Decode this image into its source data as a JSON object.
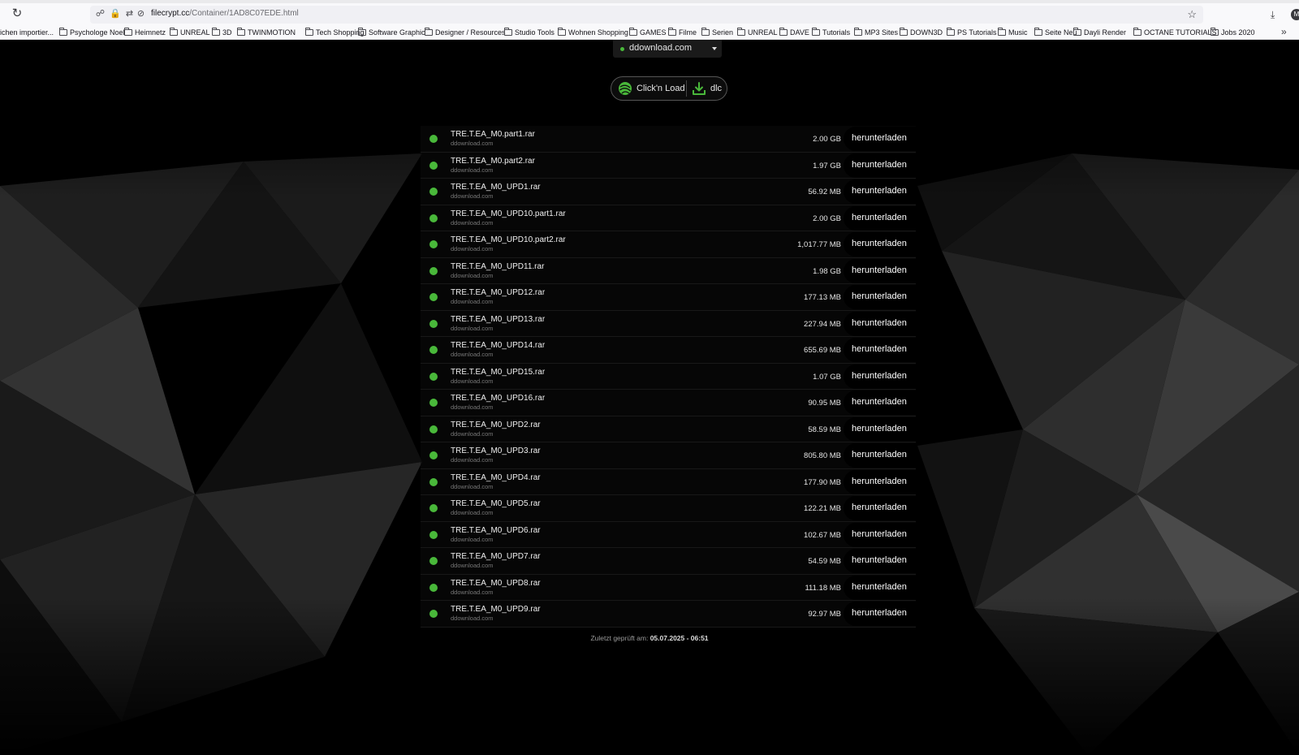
{
  "browser": {
    "url_host": "filecrypt.cc",
    "url_path": "/Container/1AD8C07EDE.html",
    "bookmarks": [
      {
        "label": "ichen importier...",
        "folder": false
      },
      {
        "label": "Psychologe Noel",
        "folder": true
      },
      {
        "label": "Heimnetz",
        "folder": true
      },
      {
        "label": "UNREAL",
        "folder": true
      },
      {
        "label": "3D",
        "folder": true
      },
      {
        "label": "TWINMOTION",
        "folder": true
      },
      {
        "label": "Tech Shopping",
        "folder": true
      },
      {
        "label": "Software Graphic",
        "folder": true
      },
      {
        "label": "Designer / Resources",
        "folder": true
      },
      {
        "label": "Studio Tools",
        "folder": true
      },
      {
        "label": "Wohnen Shopping",
        "folder": true
      },
      {
        "label": "GAMES",
        "folder": true
      },
      {
        "label": "Filme",
        "folder": true
      },
      {
        "label": "Serien",
        "folder": true
      },
      {
        "label": "UNREAL",
        "folder": true
      },
      {
        "label": "DAVE",
        "folder": true
      },
      {
        "label": "Tutorials",
        "folder": true
      },
      {
        "label": "MP3 Sites",
        "folder": true
      },
      {
        "label": "DOWN3D",
        "folder": true
      },
      {
        "label": "PS Tutorials",
        "folder": true
      },
      {
        "label": "Music",
        "folder": true
      },
      {
        "label": "Seite Neu",
        "folder": true
      },
      {
        "label": "Dayli Render",
        "folder": true
      },
      {
        "label": "OCTANE TUTORIALS",
        "folder": true
      },
      {
        "label": "Jobs 2020",
        "folder": true
      }
    ],
    "icons": {
      "reload": "reload-icon",
      "shield": "shield-icon",
      "lock": "lock-icon",
      "permissions": "permissions-icon",
      "star": "bookmark-star-icon",
      "downloads": "downloads-icon",
      "account": "account-icon",
      "overflow": "chevron-double-right-icon"
    },
    "account_initial": "M"
  },
  "mirror": {
    "selected": "ddownload.com",
    "status_color": "#49b83a"
  },
  "actions": {
    "clicknload_label": "Click'n Load",
    "dlc_label": "dlc",
    "accent": "#49b83a"
  },
  "files": [
    {
      "name": "TRE.T.EA_M0.part1.rar",
      "host": "ddownload.com",
      "size": "2.00 GB",
      "action": "herunterladen"
    },
    {
      "name": "TRE.T.EA_M0.part2.rar",
      "host": "ddownload.com",
      "size": "1.97 GB",
      "action": "herunterladen"
    },
    {
      "name": "TRE.T.EA_M0_UPD1.rar",
      "host": "ddownload.com",
      "size": "56.92 MB",
      "action": "herunterladen"
    },
    {
      "name": "TRE.T.EA_M0_UPD10.part1.rar",
      "host": "ddownload.com",
      "size": "2.00 GB",
      "action": "herunterladen"
    },
    {
      "name": "TRE.T.EA_M0_UPD10.part2.rar",
      "host": "ddownload.com",
      "size": "1,017.77 MB",
      "action": "herunterladen"
    },
    {
      "name": "TRE.T.EA_M0_UPD11.rar",
      "host": "ddownload.com",
      "size": "1.98 GB",
      "action": "herunterladen"
    },
    {
      "name": "TRE.T.EA_M0_UPD12.rar",
      "host": "ddownload.com",
      "size": "177.13 MB",
      "action": "herunterladen"
    },
    {
      "name": "TRE.T.EA_M0_UPD13.rar",
      "host": "ddownload.com",
      "size": "227.94 MB",
      "action": "herunterladen"
    },
    {
      "name": "TRE.T.EA_M0_UPD14.rar",
      "host": "ddownload.com",
      "size": "655.69 MB",
      "action": "herunterladen"
    },
    {
      "name": "TRE.T.EA_M0_UPD15.rar",
      "host": "ddownload.com",
      "size": "1.07 GB",
      "action": "herunterladen"
    },
    {
      "name": "TRE.T.EA_M0_UPD16.rar",
      "host": "ddownload.com",
      "size": "90.95 MB",
      "action": "herunterladen"
    },
    {
      "name": "TRE.T.EA_M0_UPD2.rar",
      "host": "ddownload.com",
      "size": "58.59 MB",
      "action": "herunterladen"
    },
    {
      "name": "TRE.T.EA_M0_UPD3.rar",
      "host": "ddownload.com",
      "size": "805.80 MB",
      "action": "herunterladen"
    },
    {
      "name": "TRE.T.EA_M0_UPD4.rar",
      "host": "ddownload.com",
      "size": "177.90 MB",
      "action": "herunterladen"
    },
    {
      "name": "TRE.T.EA_M0_UPD5.rar",
      "host": "ddownload.com",
      "size": "122.21 MB",
      "action": "herunterladen"
    },
    {
      "name": "TRE.T.EA_M0_UPD6.rar",
      "host": "ddownload.com",
      "size": "102.67 MB",
      "action": "herunterladen"
    },
    {
      "name": "TRE.T.EA_M0_UPD7.rar",
      "host": "ddownload.com",
      "size": "54.59 MB",
      "action": "herunterladen"
    },
    {
      "name": "TRE.T.EA_M0_UPD8.rar",
      "host": "ddownload.com",
      "size": "111.18 MB",
      "action": "herunterladen"
    },
    {
      "name": "TRE.T.EA_M0_UPD9.rar",
      "host": "ddownload.com",
      "size": "92.97 MB",
      "action": "herunterladen"
    }
  ],
  "footer": {
    "checked_label": "Zuletzt geprüft am:",
    "checked_value": "05.07.2025 - 06:51"
  }
}
